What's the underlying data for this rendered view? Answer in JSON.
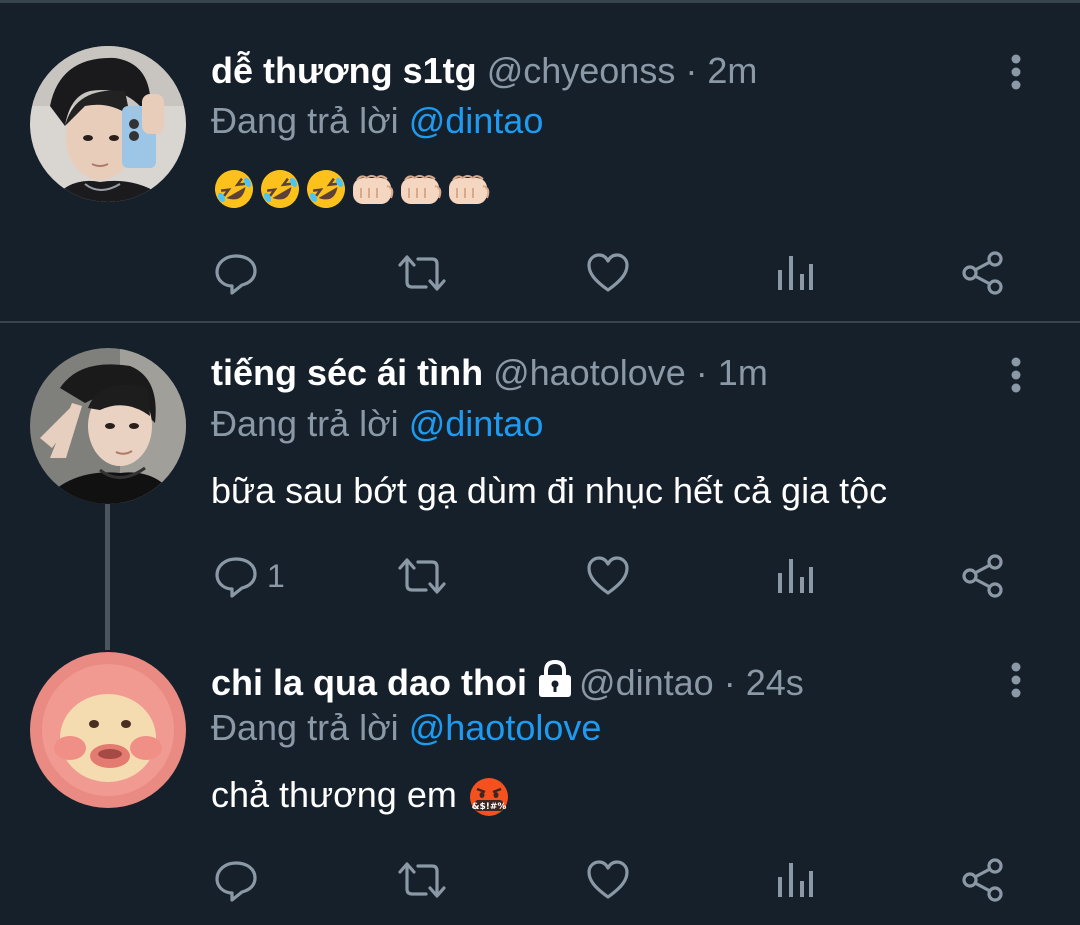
{
  "tweets": [
    {
      "name": "dễ thương s1tg",
      "handle": "@chyeonss",
      "dot": "·",
      "time": "2m",
      "reply_prefix": "Đang trả lời",
      "reply_to": "@dintao",
      "text": "",
      "emojis": [
        "rofl",
        "rofl",
        "rofl",
        "fist",
        "fist",
        "fist"
      ],
      "reply_count": "",
      "locked": false
    },
    {
      "name": "tiếng séc ái tình",
      "handle": "@haotolove",
      "dot": "·",
      "time": "1m",
      "reply_prefix": "Đang trả lời",
      "reply_to": "@dintao",
      "text": "bữa sau bớt gạ dùm đi nhục hết cả gia tộc",
      "emojis": [],
      "reply_count": "1",
      "locked": false
    },
    {
      "name": "chi la qua dao thoi",
      "handle": "@dintao",
      "dot": "·",
      "time": "24s",
      "reply_prefix": "Đang trả lời",
      "reply_to": "@haotolove",
      "text": "chả thương em",
      "emojis": [
        "cursing-face"
      ],
      "reply_count": "",
      "locked": true
    }
  ],
  "colors": {
    "background": "#15202b",
    "divider": "#38444d",
    "secondary_text": "#8b98a5",
    "link": "#1d9bf0",
    "primary_text": "#ffffff"
  },
  "icons": {
    "reply": "speech-bubble-icon",
    "retweet": "retweet-icon",
    "like": "heart-icon",
    "analytics": "bar-chart-icon",
    "share": "share-icon",
    "more": "vertical-dots-icon",
    "protected": "lock-icon"
  }
}
